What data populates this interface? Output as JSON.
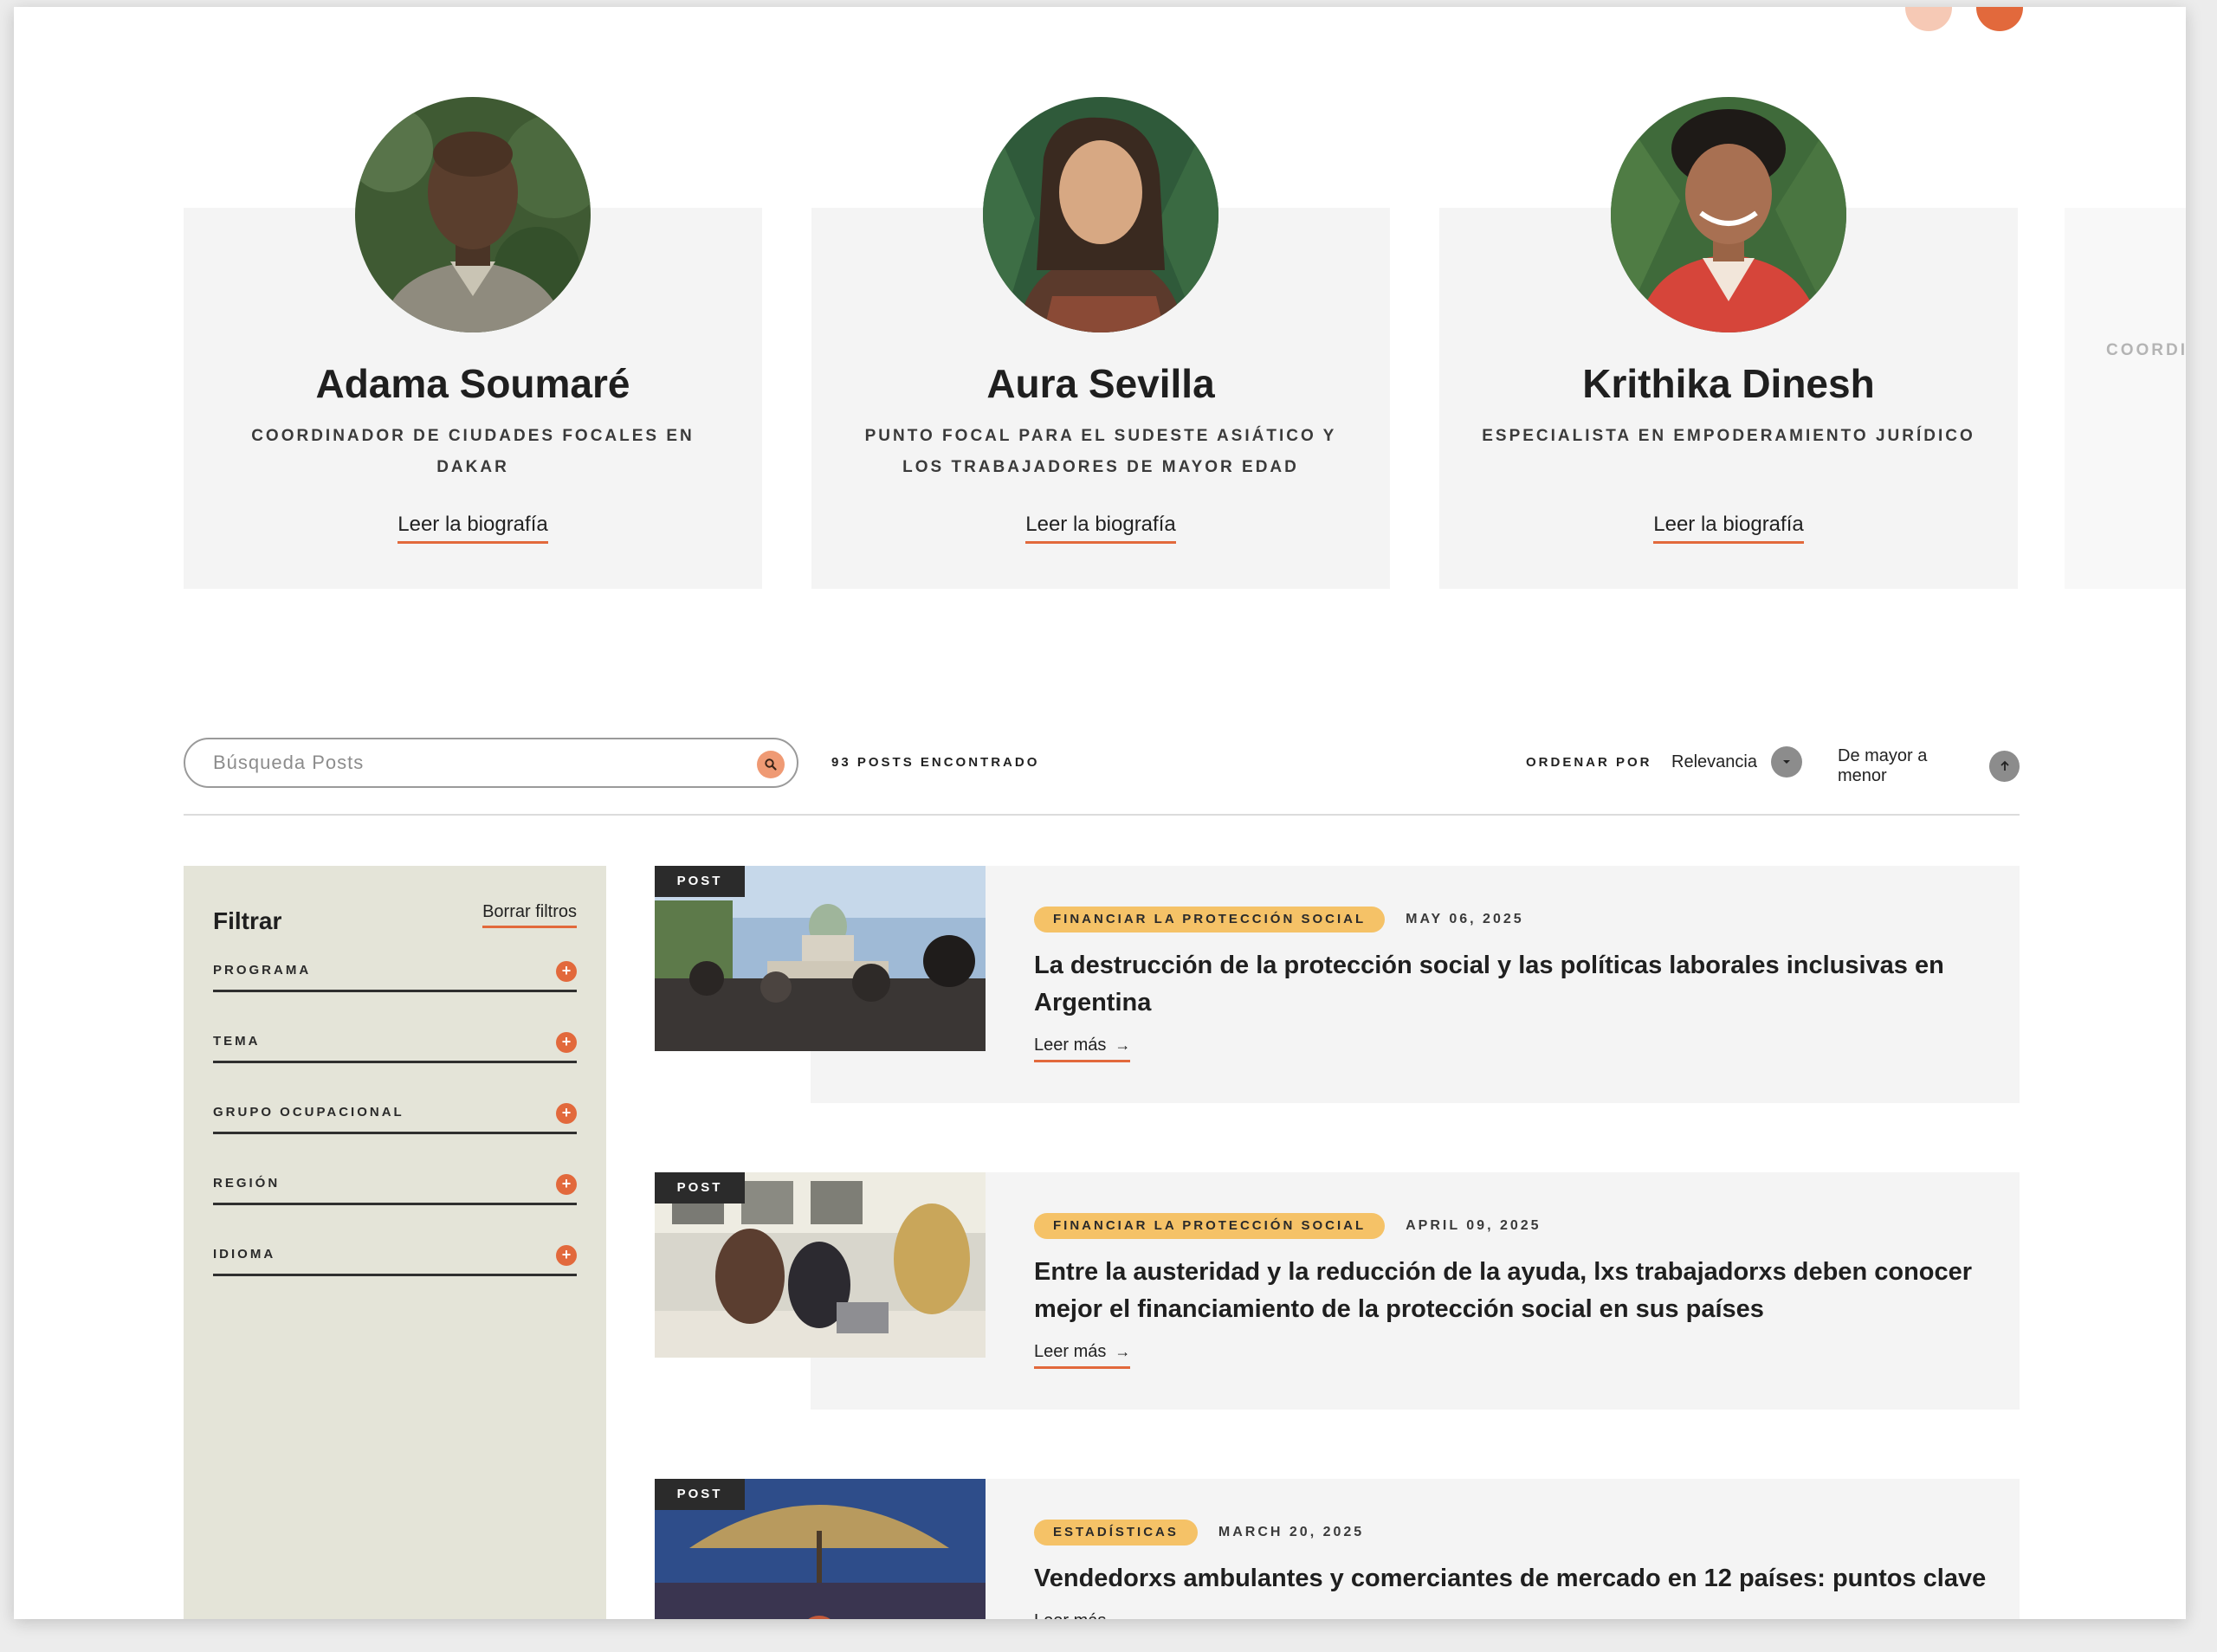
{
  "people": [
    {
      "name": "Adama Soumaré",
      "role": "COORDINADOR DE CIUDADES FOCALES EN DAKAR",
      "link": "Leer la biografía"
    },
    {
      "name": "Aura Sevilla",
      "role": "PUNTO FOCAL PARA EL SUDESTE ASIÁTICO Y LOS TRABAJADORES DE MAYOR EDAD",
      "link": "Leer la biografía"
    },
    {
      "name": "Krithika Dinesh",
      "role": "ESPECIALISTA EN EMPODERAMIENTO JURÍDICO",
      "link": "Leer la biografía"
    }
  ],
  "peek_role": "COORDI",
  "search": {
    "placeholder": "Búsqueda Posts",
    "icon": "search-icon"
  },
  "posts_count": "93 POSTS ENCONTRADO",
  "sort": {
    "label": "ORDENAR POR",
    "value": "Relevancia",
    "order": "De mayor a menor"
  },
  "filters": {
    "title": "Filtrar",
    "clear": "Borrar filtros",
    "items": [
      "PROGRAMA",
      "TEMA",
      "GRUPO OCUPACIONAL",
      "REGIÓN",
      "IDIOMA"
    ]
  },
  "posts": [
    {
      "tag": "POST",
      "category": "FINANCIAR LA PROTECCIÓN SOCIAL",
      "date": "MAY 06, 2025",
      "title": "La destrucción de la protección social y las políticas laborales inclusivas en Argentina",
      "link": "Leer más"
    },
    {
      "tag": "POST",
      "category": "FINANCIAR LA PROTECCIÓN SOCIAL",
      "date": "APRIL 09, 2025",
      "title": "Entre la austeridad y la reducción de la ayuda, lxs trabajadorxs deben conocer mejor el financiamiento de la protección social en sus países",
      "link": "Leer más"
    },
    {
      "tag": "POST",
      "category": "ESTADÍSTICAS",
      "date": "MARCH 20, 2025",
      "title": "Vendedorxs ambulantes y comerciantes de mercado en 12 países: puntos clave",
      "link": "Leer más"
    }
  ],
  "colors": {
    "accent": "#e2693c",
    "category_pill": "#f5c267",
    "filter_bg": "#e4e4d8",
    "card_bg": "#f4f4f4"
  }
}
